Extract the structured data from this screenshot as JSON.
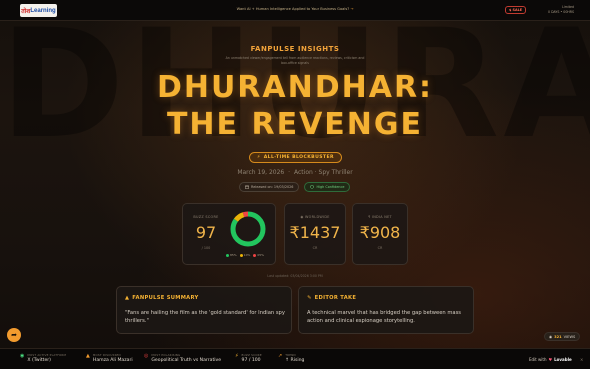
{
  "topbar": {
    "logo_text_a": "तोश",
    "logo_text_b": "Learning",
    "banner": "Want AI + Human Intelligence Applied to Your Business Goals?",
    "banner_arrow": "→",
    "sale_badge": "$ SALE",
    "sale_text_1": "Limited",
    "sale_text_2": "0 DAYS • 00HRS"
  },
  "hero": {
    "eyebrow": "FANPULSE INSIGHTS",
    "subline_1": "An unmatched viewer/engagement tell from audience reactions, reviews, criticism and",
    "subline_2": "box-office signals",
    "title_line1": "DHURANDHAR:",
    "title_line2": "THE REVENGE",
    "badge_icon": "⚡",
    "badge": "ALL-TIME BLOCKBUSTER",
    "release_date": "March 19, 2026",
    "genre": "Action · Spy Thriller",
    "chip_released": "Released on: 19/03/2026",
    "chip_confidence": "High Confidence"
  },
  "stats": {
    "score_label": "BUZZ SCORE",
    "score_value": "97",
    "score_sub": "/ 100",
    "ww_label": "WORLDWIDE",
    "ww_value": "₹1437",
    "ww_sub": "CR",
    "india_label": "INDIA NET",
    "india_value": "₹908",
    "india_sub": "CR",
    "updated": "Last updated: 03/04/2026 3:00 PM"
  },
  "chart_data": {
    "type": "pie",
    "categories": [
      "positive",
      "mixed",
      "negative"
    ],
    "values": [
      85,
      10,
      5
    ],
    "legend_labels": [
      "85%",
      "10%",
      "05%"
    ],
    "colors": [
      "#22c55e",
      "#eab308",
      "#ef4444"
    ]
  },
  "summary": {
    "heading": "FANPULSE SUMMARY",
    "body": "\"Fans are hailing the film as the 'gold standard' for Indian spy thrillers.\""
  },
  "editor": {
    "heading": "EDITOR TAKE",
    "body": "A technical marvel that has bridged the gap between mass action and clinical espionage storytelling."
  },
  "views": {
    "count": "321",
    "label": "VIEWS"
  },
  "footer": {
    "items": [
      {
        "label": "MOST ACTIVE PLATFORM",
        "value": "X (Twitter)"
      },
      {
        "label": "MOST DISCUSSED",
        "value": "Hamza Ali Mazari"
      },
      {
        "label": "MOST POLARISING",
        "value": "Geopolitical Truth vs Narrative"
      },
      {
        "label": "BUZZ SCORE",
        "value": "97 / 100"
      },
      {
        "label": "TREND",
        "value": "↑ Rising"
      }
    ],
    "lovable_pre": "Edit with",
    "lovable_brand": "Lovable",
    "close": "×"
  },
  "icons": {
    "calendar": "calendar-icon",
    "shield": "shield-icon",
    "globe": "globe-icon",
    "rupee": "rupee-icon",
    "fire": "fire-icon",
    "pen": "pen-icon",
    "share": "share-icon",
    "eye": "eye-icon"
  },
  "colors": {
    "accent": "#f5b233",
    "background": "#15100c",
    "card": "#1c1714",
    "positive": "#22c55e"
  }
}
